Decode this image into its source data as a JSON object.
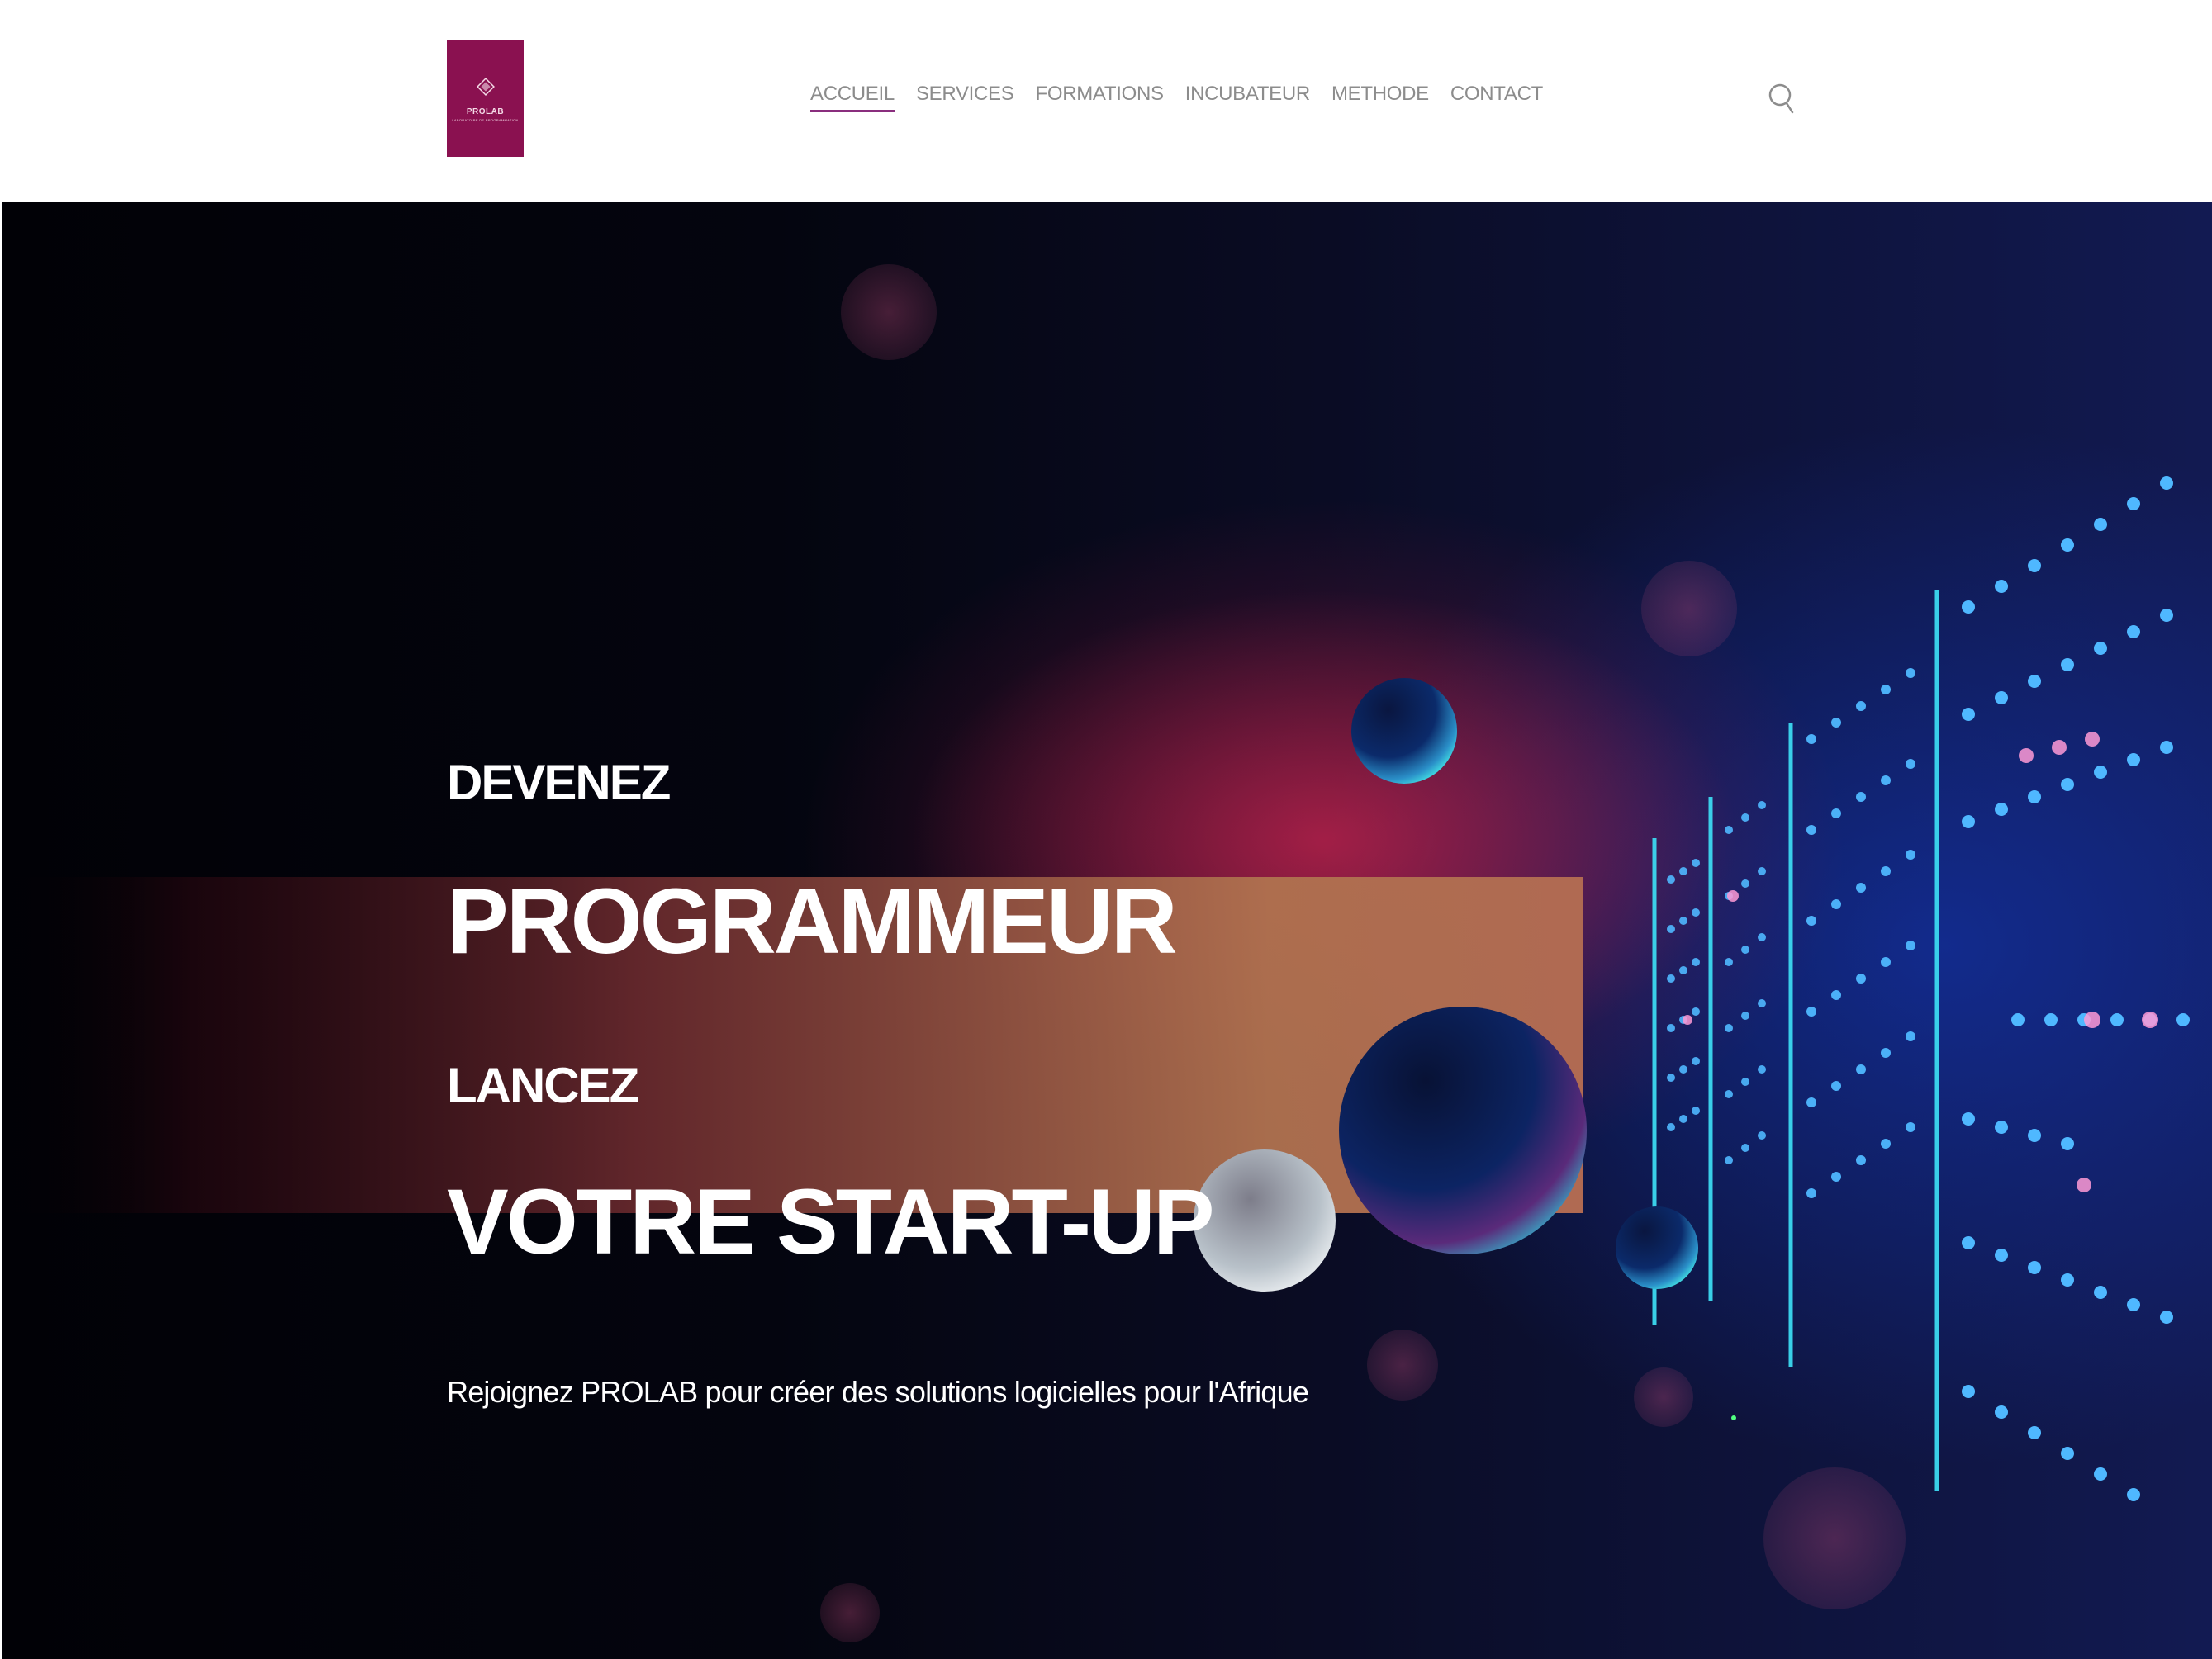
{
  "header": {
    "logo": {
      "name": "PROLAB",
      "subtitle": "LABORATOIRE DE PROGRAMMATION",
      "color": "#8a1150"
    },
    "nav": [
      {
        "label": "ACCUEIL",
        "active": true
      },
      {
        "label": "SERVICES",
        "active": false
      },
      {
        "label": "FORMATIONS",
        "active": false
      },
      {
        "label": "INCUBATEUR",
        "active": false
      },
      {
        "label": "METHODE",
        "active": false
      },
      {
        "label": "CONTACT",
        "active": false
      }
    ],
    "search_icon": "search-icon",
    "active_underline_color": "#8a2e7e"
  },
  "hero": {
    "line1": "DEVENEZ",
    "line2": "PROGRAMMEUR",
    "line3": "LANCEZ",
    "line4": "VOTRE START-UP",
    "tagline": "Rejoignez PROLAB pour créer des solutions logicielles pour l'Afrique"
  }
}
